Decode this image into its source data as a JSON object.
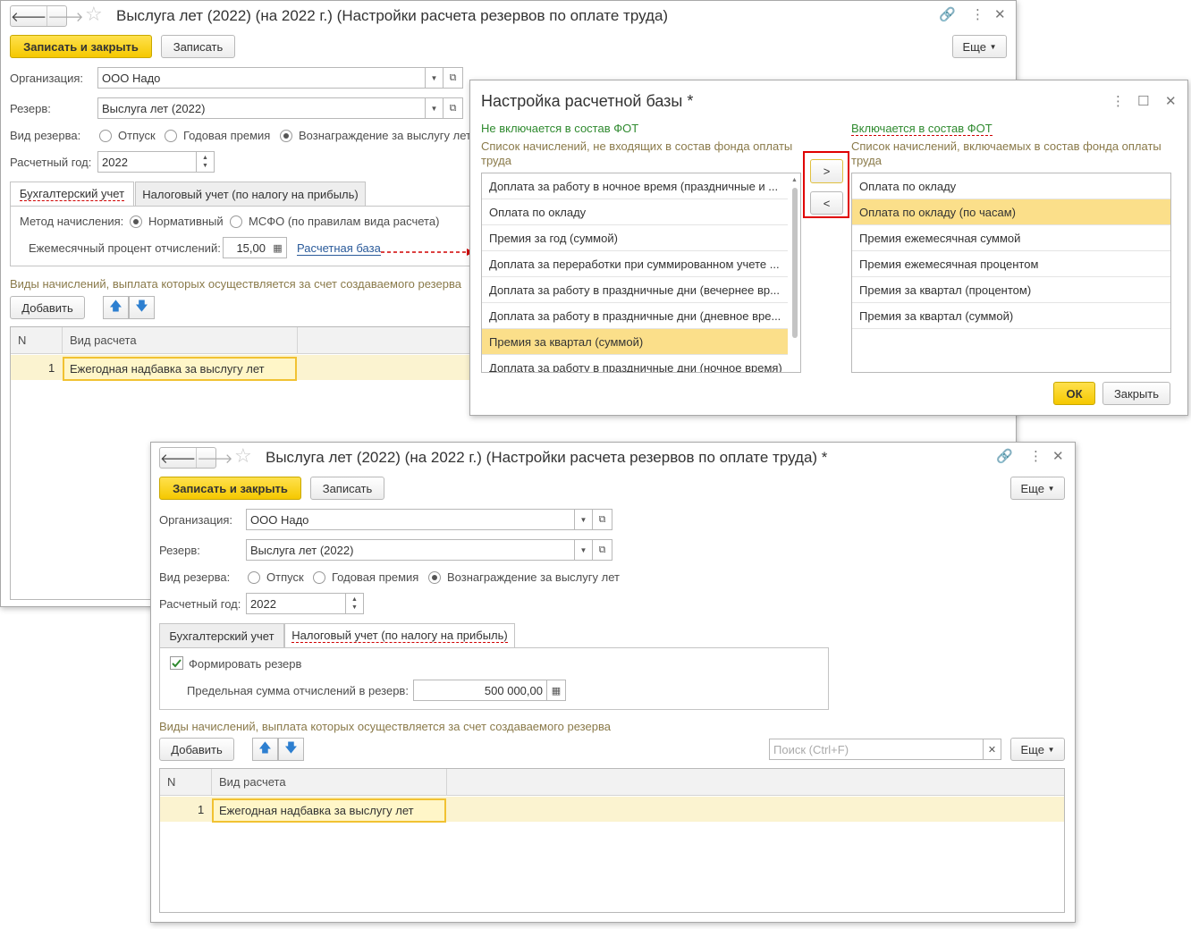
{
  "w1": {
    "title": "Выслуга лет (2022) (на 2022 г.) (Настройки расчета резервов по оплате труда)",
    "save_close": "Записать и закрыть",
    "save": "Записать",
    "more": "Еще",
    "org_label": "Организация:",
    "org_value": "ООО Надо",
    "reserve_label": "Резерв:",
    "reserve_value": "Выслуга лет (2022)",
    "kind_label": "Вид резерва:",
    "kind_options": [
      "Отпуск",
      "Годовая премия",
      "Вознаграждение за выслугу лет"
    ],
    "year_label": "Расчетный год:",
    "year_value": "2022",
    "tabs": [
      "Бухгалтерский учет",
      "Налоговый учет (по налогу на прибыль)"
    ],
    "method_label": "Метод начисления:",
    "method_options": [
      "Нормативный",
      "МСФО (по правилам вида расчета)"
    ],
    "percent_label": "Ежемесячный процент отчислений:",
    "percent_value": "15,00",
    "base_link": "Расчетная база",
    "section_note": "Виды начислений, выплата которых осуществляется за счет создаваемого резерва",
    "add": "Добавить",
    "col_n": "N",
    "col_kind": "Вид расчета",
    "rows": [
      {
        "n": "1",
        "kind": "Ежегодная надбавка за выслугу лет"
      }
    ]
  },
  "dialog": {
    "title": "Настройка расчетной базы *",
    "left_head": "Не включается в состав ФОТ",
    "left_desc": "Список начислений, не входящих в состав фонда оплаты труда",
    "right_head": "Включается в состав ФОТ",
    "right_desc": "Список начислений, включаемых в состав фонда оплаты труда",
    "left_items": [
      "Доплата за работу в ночное время (праздничные и ...",
      "Оплата по окладу",
      "Премия за год (суммой)",
      "Доплата за переработки при суммированном учете ...",
      "Доплата за работу в праздничные дни (вечернее вр...",
      "Доплата за работу в праздничные дни (дневное вре...",
      "Премия за квартал (суммой)",
      "Доплата за работу в праздничные дни (ночное время)"
    ],
    "right_items": [
      "Оплата по окладу",
      "Оплата по окладу (по часам)",
      "Премия ежемесячная суммой",
      "Премия ежемесячная процентом",
      "Премия за квартал (процентом)",
      "Премия за квартал (суммой)"
    ],
    "move_right": ">",
    "move_left": "<",
    "ok": "ОК",
    "close": "Закрыть"
  },
  "w2": {
    "title": "Выслуга лет (2022) (на 2022 г.) (Настройки расчета резервов по оплате труда) *",
    "save_close": "Записать и закрыть",
    "save": "Записать",
    "more": "Еще",
    "org_label": "Организация:",
    "org_value": "ООО Надо",
    "reserve_label": "Резерв:",
    "reserve_value": "Выслуга лет (2022)",
    "kind_label": "Вид резерва:",
    "kind_options": [
      "Отпуск",
      "Годовая премия",
      "Вознаграждение за выслугу лет"
    ],
    "year_label": "Расчетный год:",
    "year_value": "2022",
    "tabs": [
      "Бухгалтерский учет",
      "Налоговый учет (по налогу на прибыль)"
    ],
    "form_reserve": "Формировать резерв",
    "limit_label": "Предельная сумма отчислений в резерв:",
    "limit_value": "500 000,00",
    "section_note": "Виды начислений, выплата которых осуществляется за счет создаваемого резерва",
    "add": "Добавить",
    "search_placeholder": "Поиск (Ctrl+F)",
    "col_n": "N",
    "col_kind": "Вид расчета",
    "rows": [
      {
        "n": "1",
        "kind": "Ежегодная надбавка за выслугу лет"
      }
    ]
  },
  "colors": {
    "accent": "#f5c800",
    "note": "#8a7a4a",
    "green": "#2f8a2f",
    "highlight": "#fbdf8a",
    "link": "#2a5a9a",
    "callout": "#e00000"
  }
}
